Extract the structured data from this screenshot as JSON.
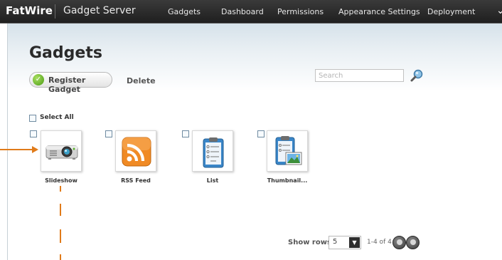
{
  "header": {
    "brand": "FatWire",
    "product": "Gadget Server",
    "nav": [
      "Gadgets",
      "Dashboard",
      "Permissions",
      "Appearance Settings",
      "Deployment"
    ],
    "menu_icon": "chevron-down-icon"
  },
  "page": {
    "title": "Gadgets",
    "register_label": "Register Gadget",
    "delete_label": "Delete",
    "search_placeholder": "Search",
    "select_all_label": "Select All"
  },
  "gadgets": [
    {
      "label": "Slideshow",
      "icon": "projector-icon"
    },
    {
      "label": "RSS Feed",
      "icon": "rss-icon"
    },
    {
      "label": "List",
      "icon": "clipboard-list-icon"
    },
    {
      "label": "Thumbnail...",
      "icon": "clipboard-thumbnail-icon"
    }
  ],
  "pagination": {
    "show_rows_label": "Show rows:",
    "rows_value": "5",
    "range": "1-4 of 4"
  },
  "colors": {
    "topbar": "#2b2b2b",
    "accent_annotation": "#e07b1a",
    "rss": "#f08a24",
    "check_green": "#5aa61e"
  }
}
